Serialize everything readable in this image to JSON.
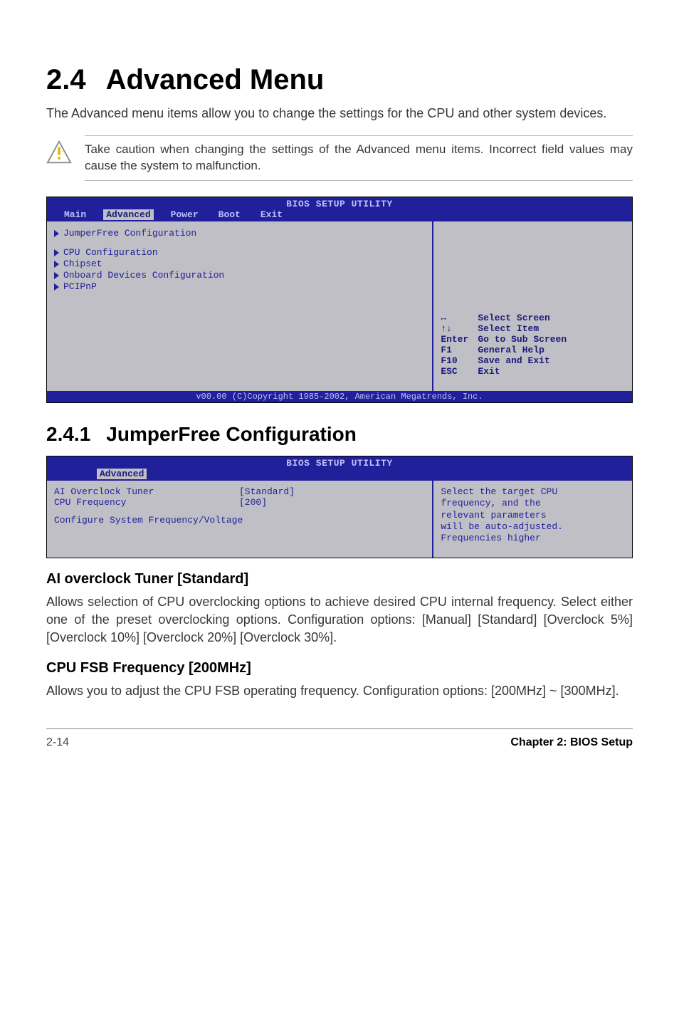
{
  "page": {
    "title_num": "2.4",
    "title_text": "Advanced Menu",
    "intro": "The Advanced menu items allow you to change the settings for the CPU and other system devices.",
    "caution": "Take caution when changing the settings of the Advanced menu items. Incorrect field values may cause the system to malfunction."
  },
  "bios1": {
    "header_title": "BIOS SETUP UTILITY",
    "tabs": {
      "main": "Main",
      "advanced": "Advanced",
      "power": "Power",
      "boot": "Boot",
      "exit": "Exit"
    },
    "menu": {
      "jumperfree": "JumperFree Configuration",
      "cpu": "CPU Configuration",
      "chipset": "Chipset",
      "onboard": "Onboard Devices Configuration",
      "pcipnp": "PCIPnP"
    },
    "help": {
      "k1": "↔",
      "l1": "Select Screen",
      "k2": "↑↓",
      "l2": "Select Item",
      "k3": "Enter",
      "l3": "Go to Sub Screen",
      "k4": "F1",
      "l4": "General Help",
      "k5": "F10",
      "l5": "Save and Exit",
      "k6": "ESC",
      "l6": "Exit"
    },
    "footer": "v00.00 (C)Copyright 1985-2002, American Megatrends, Inc."
  },
  "section241": {
    "num": "2.4.1",
    "title": "JumperFree Configuration"
  },
  "bios2": {
    "header_title": "BIOS SETUP UTILITY",
    "tab": "Advanced",
    "row1_label": "AI Overclock Tuner",
    "row1_val": "[Standard]",
    "row2_label": "CPU Frequency",
    "row2_val": "[200]",
    "row3_label": "Configure System Frequency/Voltage",
    "desc1": "Select the target CPU",
    "desc2": "frequency, and the",
    "desc3": "relevant parameters",
    "desc4": "will be auto-adjusted.",
    "desc5": "Frequencies higher"
  },
  "ai": {
    "heading": "AI overclock Tuner [Standard]",
    "body": "Allows selection of CPU overclocking options to achieve desired CPU internal frequency. Select either one of the preset overclocking options. Configuration options: [Manual] [Standard] [Overclock 5%] [Overclock 10%] [Overclock 20%] [Overclock 30%]."
  },
  "fsb": {
    "heading": "CPU FSB Frequency [200MHz]",
    "body": "Allows you to adjust the CPU FSB operating frequency. Configuration options: [200MHz]  ~  [300MHz]."
  },
  "footer": {
    "left": "2-14",
    "right": "Chapter 2: BIOS Setup"
  }
}
